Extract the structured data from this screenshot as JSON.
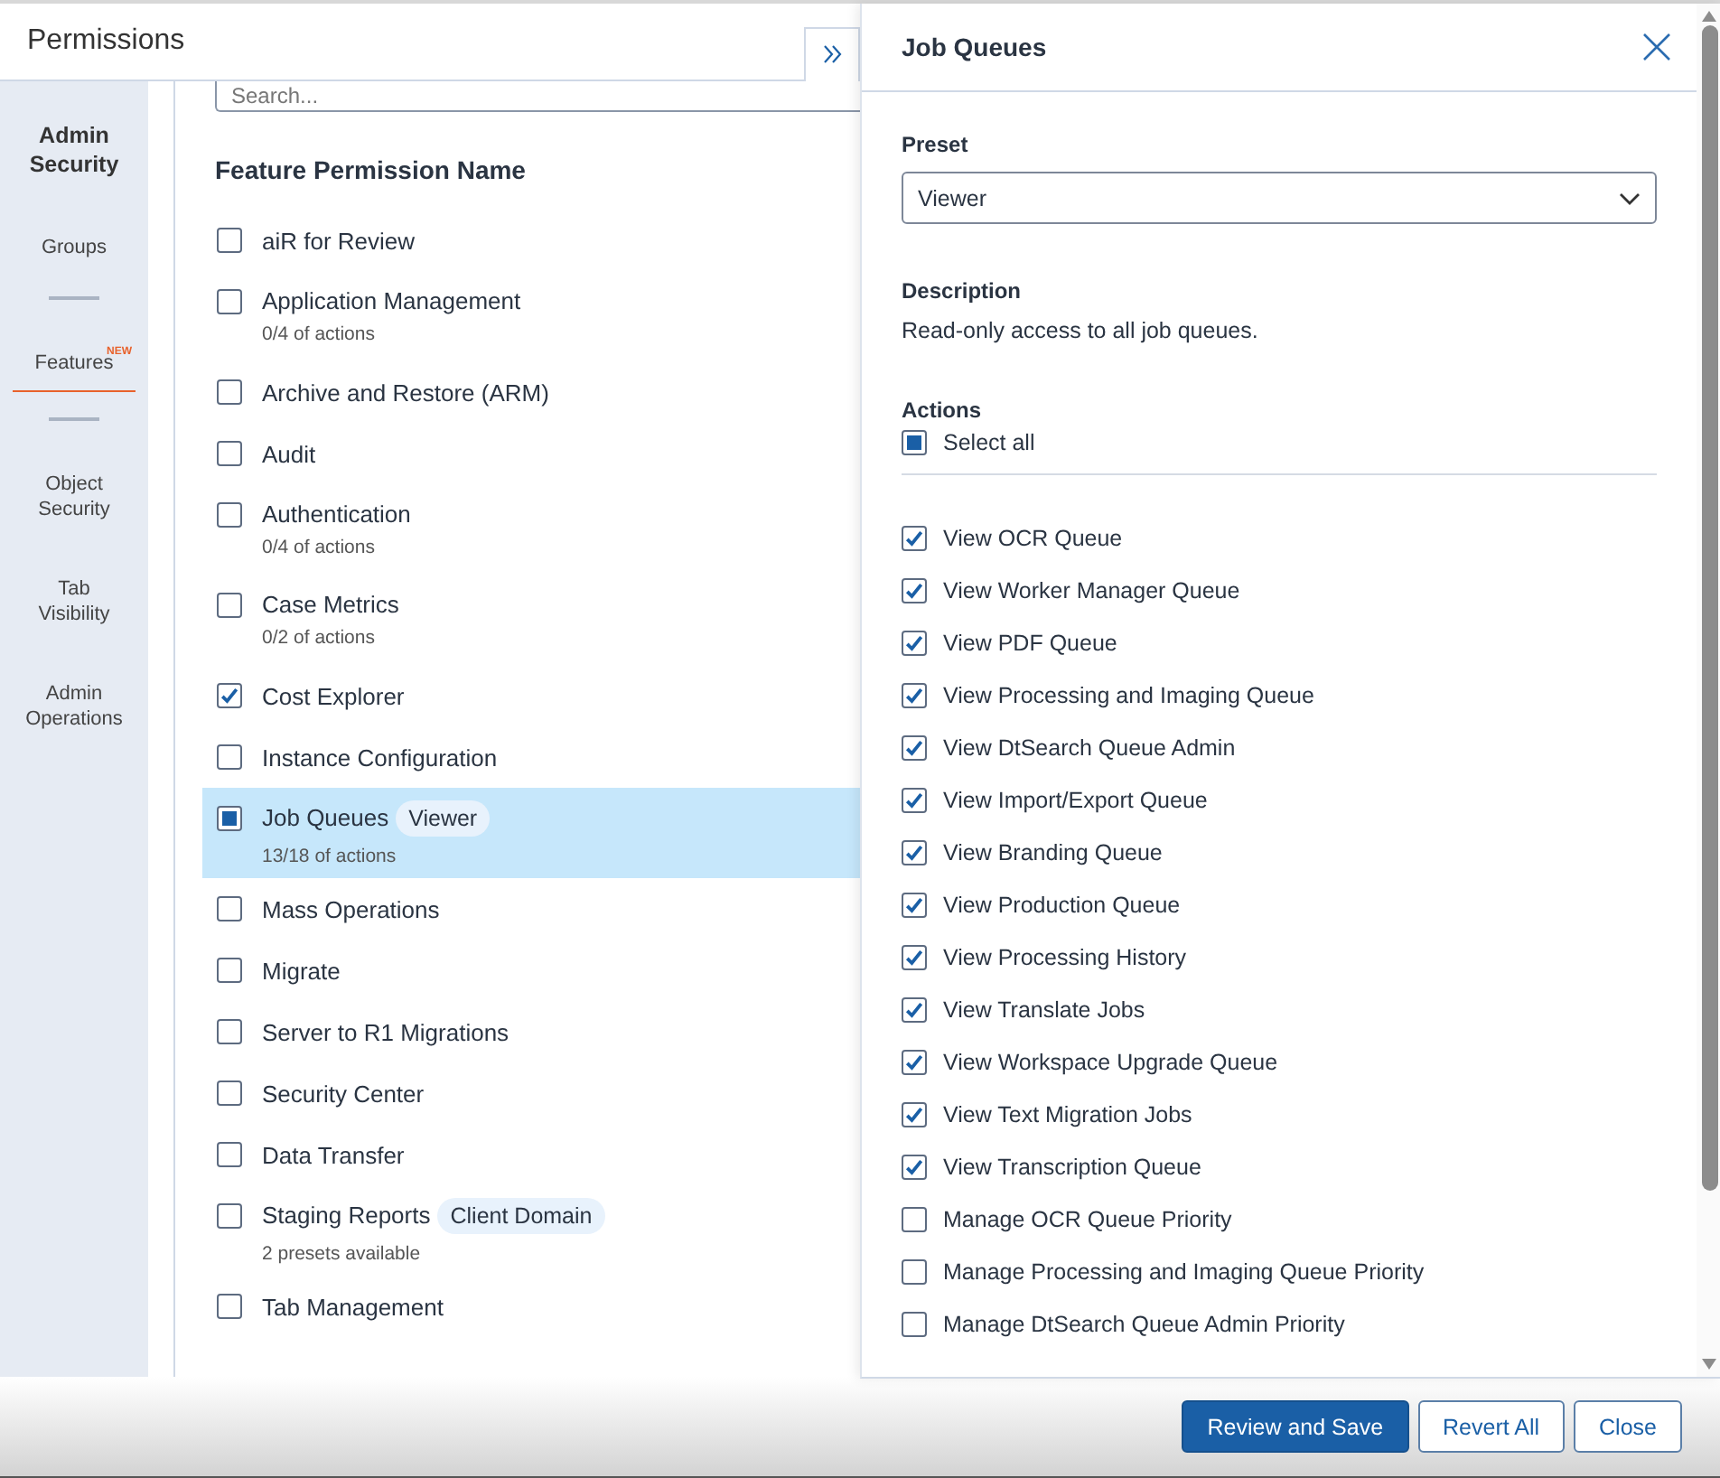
{
  "header": {
    "title": "Permissions"
  },
  "sidebar": {
    "heading": "Admin Security",
    "items": [
      {
        "label": "Groups",
        "selected": false
      },
      {
        "label": "Features",
        "badge": "NEW",
        "selected": true
      },
      {
        "label": "Object Security",
        "selected": false
      },
      {
        "label": "Tab Visibility",
        "selected": false
      },
      {
        "label": "Admin Operations",
        "selected": false
      }
    ]
  },
  "search": {
    "placeholder": "Search..."
  },
  "column_heading": "Feature Permission Name",
  "features": [
    {
      "name": "aiR for Review",
      "checked": false,
      "selected": false
    },
    {
      "name": "Application Management",
      "note": "0/4 of actions",
      "checked": false,
      "selected": false
    },
    {
      "name": "Archive and Restore (ARM)",
      "checked": false,
      "selected": false
    },
    {
      "name": "Audit",
      "checked": false,
      "selected": false
    },
    {
      "name": "Authentication",
      "note": "0/4 of actions",
      "checked": false,
      "selected": false
    },
    {
      "name": "Case Metrics",
      "note": "0/2 of actions",
      "checked": false,
      "selected": false
    },
    {
      "name": "Cost Explorer",
      "checked": true,
      "selected": false
    },
    {
      "name": "Instance Configuration",
      "checked": false,
      "selected": false
    },
    {
      "name": "Job Queues",
      "badge": "Viewer",
      "note": "13/18 of actions",
      "checked": false,
      "partial": true,
      "selected": true
    },
    {
      "name": "Mass Operations",
      "checked": false,
      "selected": false
    },
    {
      "name": "Migrate",
      "checked": false,
      "selected": false
    },
    {
      "name": "Server to R1 Migrations",
      "checked": false,
      "selected": false
    },
    {
      "name": "Security Center",
      "checked": false,
      "selected": false
    },
    {
      "name": "Data Transfer",
      "checked": false,
      "selected": false
    },
    {
      "name": "Staging Reports",
      "badge": "Client Domain",
      "note": "2 presets available",
      "checked": false,
      "selected": false
    },
    {
      "name": "Tab Management",
      "checked": false,
      "selected": false
    }
  ],
  "panel": {
    "title": "Job Queues",
    "preset_label": "Preset",
    "preset_value": "Viewer",
    "description_label": "Description",
    "description": "Read-only access to all job queues.",
    "actions_label": "Actions",
    "select_all": {
      "label": "Select all",
      "checked": false,
      "partial": true
    },
    "actions": [
      {
        "label": "View OCR Queue",
        "checked": true
      },
      {
        "label": "View Worker Manager Queue",
        "checked": true
      },
      {
        "label": "View PDF Queue",
        "checked": true
      },
      {
        "label": "View Processing and Imaging Queue",
        "checked": true
      },
      {
        "label": "View DtSearch Queue Admin",
        "checked": true
      },
      {
        "label": "View Import/Export Queue",
        "checked": true
      },
      {
        "label": "View Branding Queue",
        "checked": true
      },
      {
        "label": "View Production Queue",
        "checked": true
      },
      {
        "label": "View Processing History",
        "checked": true
      },
      {
        "label": "View Translate Jobs",
        "checked": true
      },
      {
        "label": "View Workspace Upgrade Queue",
        "checked": true
      },
      {
        "label": "View Text Migration Jobs",
        "checked": true
      },
      {
        "label": "View Transcription Queue",
        "checked": true
      },
      {
        "label": "Manage OCR Queue Priority",
        "checked": false
      },
      {
        "label": "Manage Processing and Imaging Queue Priority",
        "checked": false
      },
      {
        "label": "Manage DtSearch Queue Admin Priority",
        "checked": false
      }
    ]
  },
  "footer": {
    "buttons": [
      {
        "label": "Review and Save",
        "kind": "primary"
      },
      {
        "label": "Revert All",
        "kind": "secondary"
      },
      {
        "label": "Close",
        "kind": "secondary"
      }
    ]
  }
}
